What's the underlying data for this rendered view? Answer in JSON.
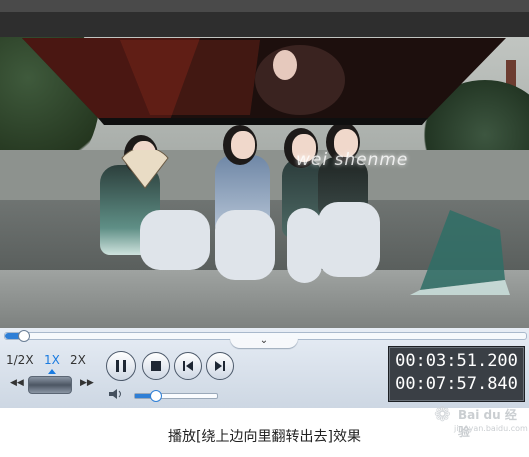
{
  "video": {
    "overlay_text": "wei shenme"
  },
  "controls": {
    "speed_options": [
      "1/2X",
      "1X",
      "2X"
    ],
    "speed_selected": "1X",
    "skip_back_icon": "◀◀",
    "skip_forward_icon": "▶▶",
    "progress_fraction": 0.035,
    "volume_fraction": 0.24,
    "time_current": "00:03:51.200",
    "time_total": "00:07:57.840",
    "collapse_icon": "chevron-down"
  },
  "caption": "播放[绕上边向里翻转出去]效果",
  "watermark": {
    "brand": "Bai du 经验",
    "url": "jingyan.baidu.com"
  },
  "colors": {
    "accent": "#2f7fd6",
    "time_bg": "#3a3f45"
  }
}
